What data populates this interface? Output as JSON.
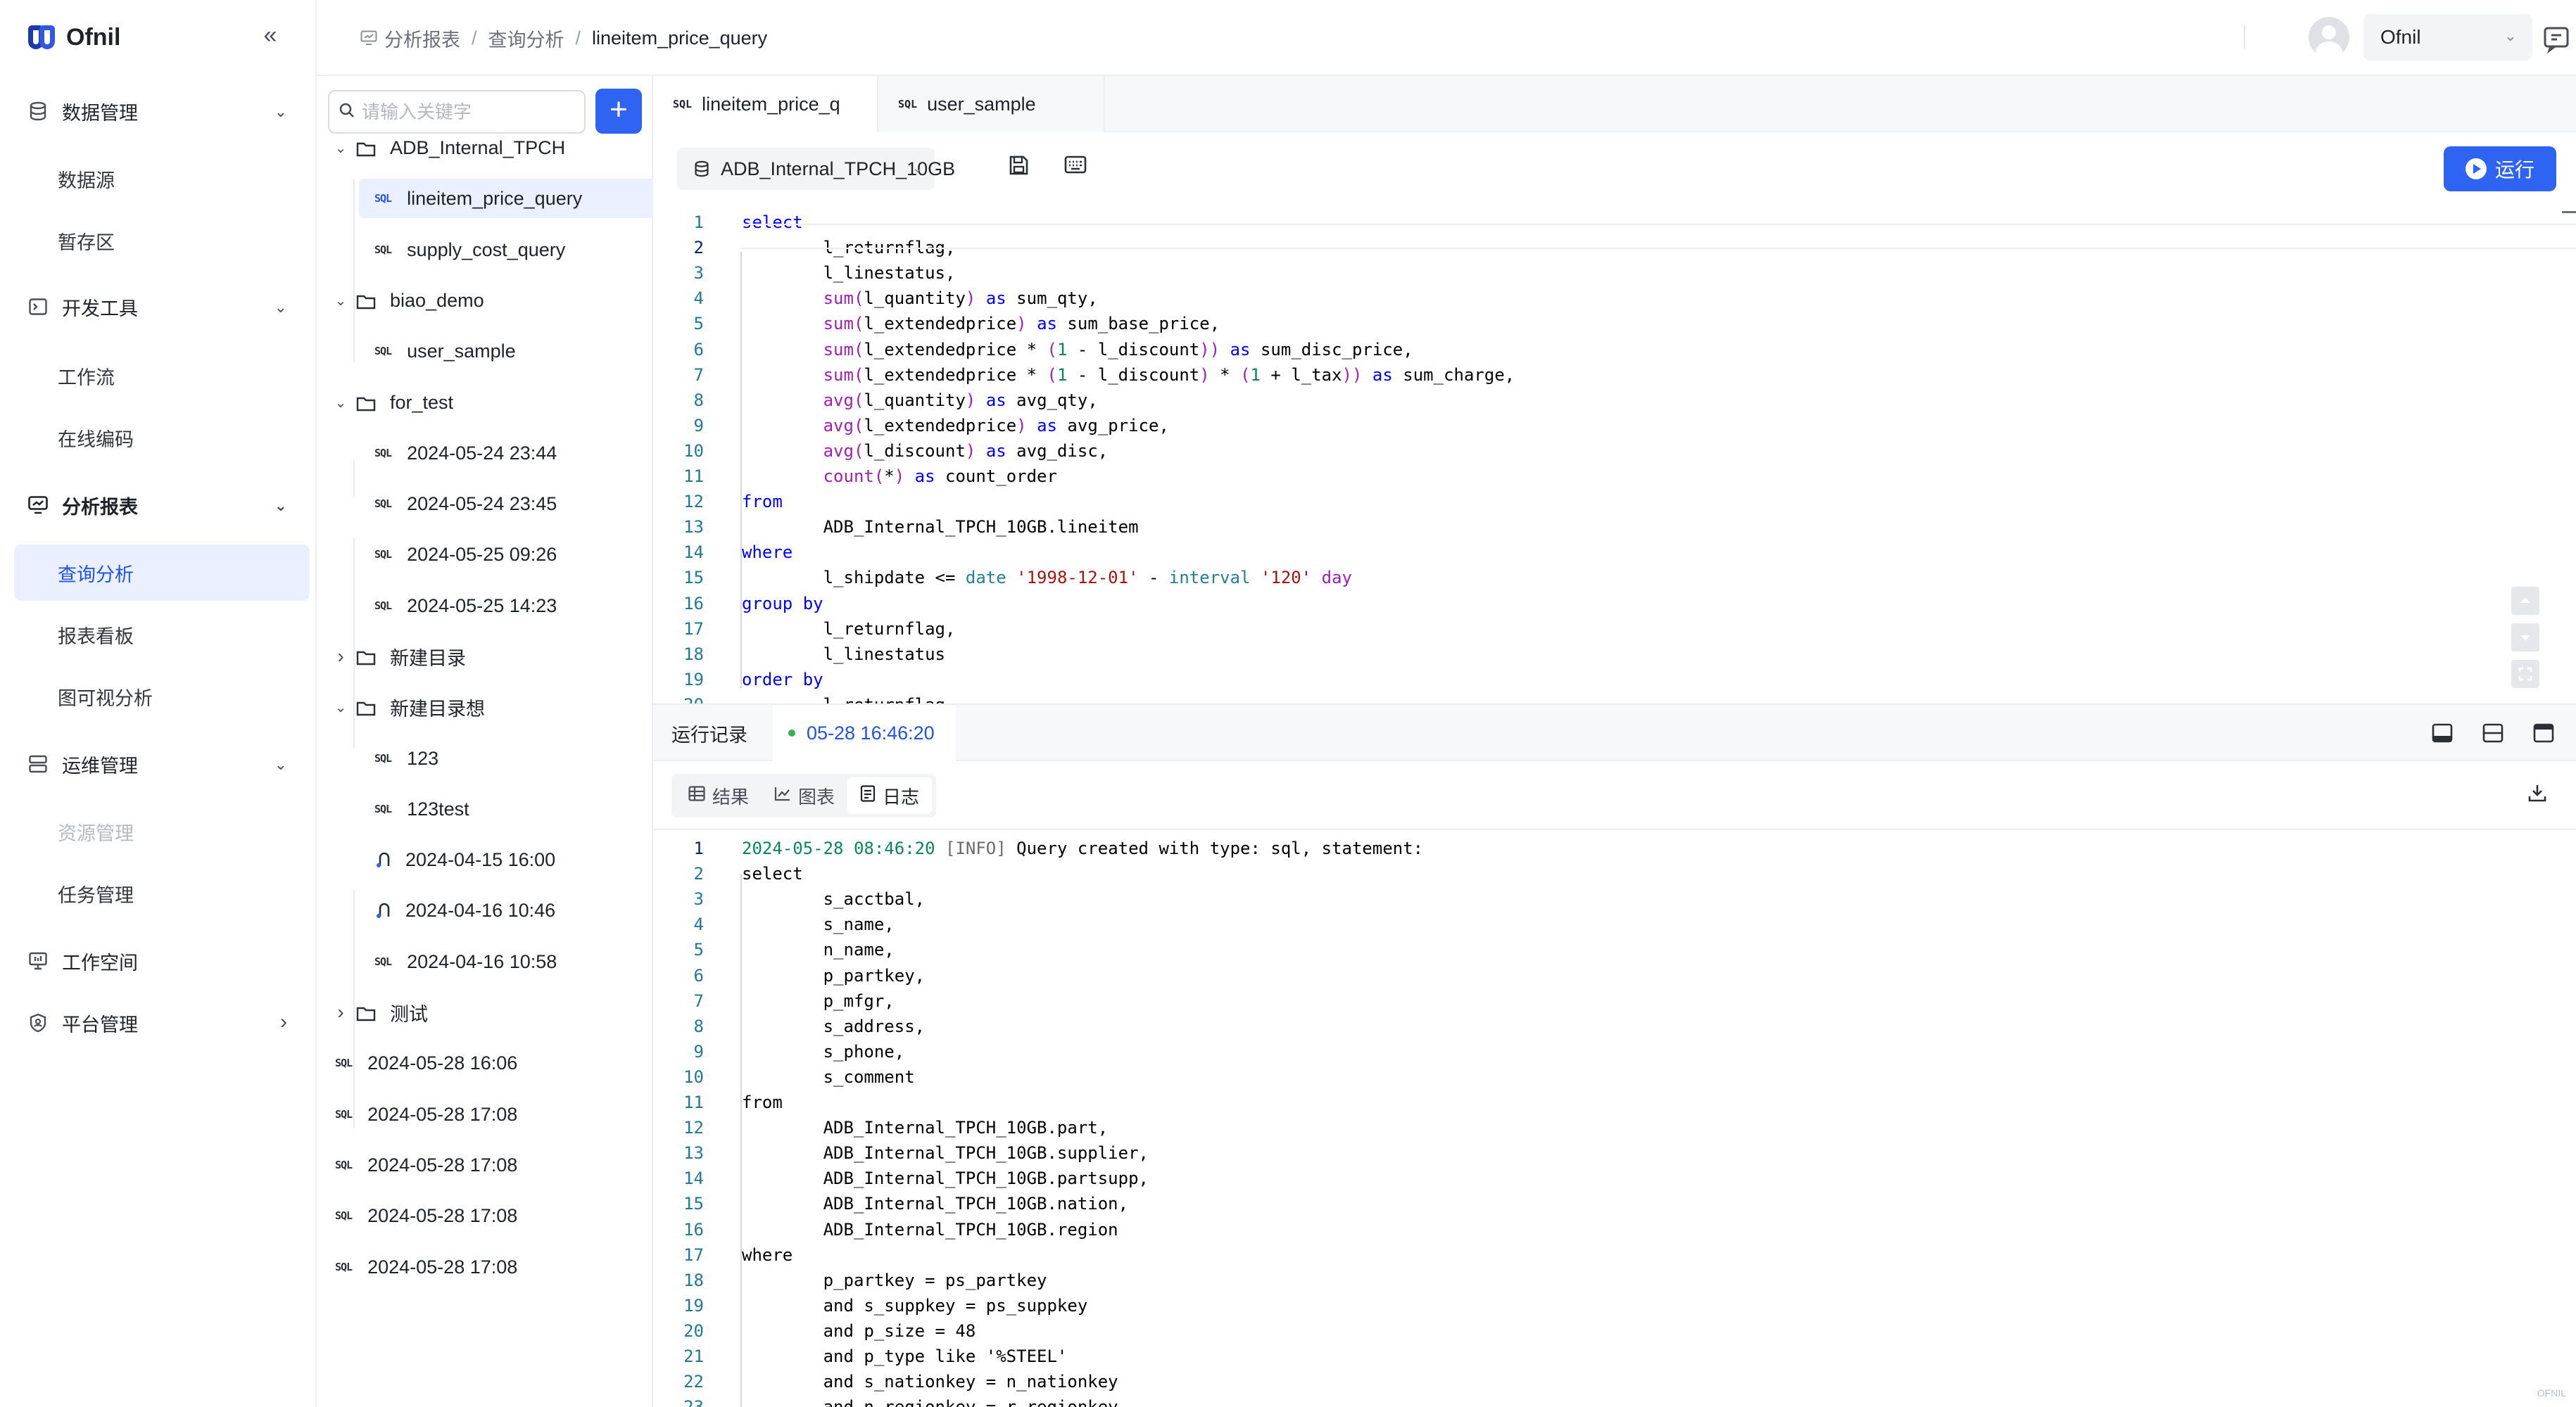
{
  "brand": {
    "name": "Ofnil"
  },
  "sidebar": {
    "groups": [
      {
        "label": "数据管理",
        "items": [
          "数据源",
          "暂存区"
        ]
      },
      {
        "label": "开发工具",
        "items": [
          "工作流",
          "在线编码"
        ]
      },
      {
        "label": "分析报表",
        "items": [
          "查询分析",
          "报表看板",
          "图可视分析"
        ]
      },
      {
        "label": "运维管理",
        "items": [
          "资源管理",
          "任务管理"
        ]
      },
      {
        "label": "工作空间",
        "items": []
      },
      {
        "label": "平台管理",
        "items": []
      }
    ]
  },
  "header": {
    "breadcrumb": [
      "分析报表",
      "查询分析",
      "lineitem_price_query"
    ],
    "user": "Ofnil"
  },
  "tree": {
    "search_placeholder": "请输入关键字",
    "nodes": [
      {
        "type": "folder",
        "label": "ADB_Internal_TPCH",
        "expanded": true
      },
      {
        "type": "sql",
        "label": "lineitem_price_query",
        "selected": true
      },
      {
        "type": "sql",
        "label": "supply_cost_query"
      },
      {
        "type": "folder",
        "label": "biao_demo",
        "expanded": true
      },
      {
        "type": "sql",
        "label": "user_sample"
      },
      {
        "type": "folder",
        "label": "for_test",
        "expanded": true
      },
      {
        "type": "sql",
        "label": "2024-05-24 23:44"
      },
      {
        "type": "sql",
        "label": "2024-05-24 23:45"
      },
      {
        "type": "sql",
        "label": "2024-05-25 09:26"
      },
      {
        "type": "sql",
        "label": "2024-05-25 14:23"
      },
      {
        "type": "folder",
        "label": "新建目录",
        "expanded": false
      },
      {
        "type": "folder",
        "label": "新建目录想",
        "expanded": true
      },
      {
        "type": "sql",
        "label": "123"
      },
      {
        "type": "sql",
        "label": "123test"
      },
      {
        "type": "flow",
        "label": "2024-04-15 16:00"
      },
      {
        "type": "flow",
        "label": "2024-04-16 10:46"
      },
      {
        "type": "sql",
        "label": "2024-04-16 10:58"
      },
      {
        "type": "folder",
        "label": "测试",
        "expanded": false
      },
      {
        "type": "sql",
        "label": "2024-05-28 16:06"
      },
      {
        "type": "sql",
        "label": "2024-05-28 17:08"
      },
      {
        "type": "sql",
        "label": "2024-05-28 17:08"
      },
      {
        "type": "sql",
        "label": "2024-05-28 17:08"
      },
      {
        "type": "sql",
        "label": "2024-05-28 17:08"
      }
    ]
  },
  "editor": {
    "tabs": [
      {
        "label": "lineitem_price_q",
        "active": true
      },
      {
        "label": "user_sample",
        "active": false
      }
    ],
    "datasource": "ADB_Internal_TPCH_10GB",
    "run_label": "运行",
    "current_line": 2,
    "lines": [
      "select",
      "        l_returnflag,",
      "        l_linestatus,",
      "        sum(l_quantity) as sum_qty,",
      "        sum(l_extendedprice) as sum_base_price,",
      "        sum(l_extendedprice * (1 - l_discount)) as sum_disc_price,",
      "        sum(l_extendedprice * (1 - l_discount) * (1 + l_tax)) as sum_charge,",
      "        avg(l_quantity) as avg_qty,",
      "        avg(l_extendedprice) as avg_price,",
      "        avg(l_discount) as avg_disc,",
      "        count(*) as count_order",
      "from",
      "        ADB_Internal_TPCH_10GB.lineitem",
      "where",
      "        l_shipdate <= date '1998-12-01' - interval '120' day",
      "group by",
      "        l_returnflag,",
      "        l_linestatus",
      "order by",
      "        l_returnflag,"
    ]
  },
  "run": {
    "records_label": "运行记录",
    "entry": "05-28 16:46:20",
    "result_tabs": [
      "结果",
      "图表",
      "日志"
    ],
    "active_result_tab": "日志",
    "log_first": {
      "time": "2024-05-28 08:46:20",
      "tag": "[INFO]",
      "msg": " Query created with type: sql, statement:"
    },
    "log_lines": [
      "select",
      "        s_acctbal,",
      "        s_name,",
      "        n_name,",
      "        p_partkey,",
      "        p_mfgr,",
      "        s_address,",
      "        s_phone,",
      "        s_comment",
      "from",
      "        ADB_Internal_TPCH_10GB.part,",
      "        ADB_Internal_TPCH_10GB.supplier,",
      "        ADB_Internal_TPCH_10GB.partsupp,",
      "        ADB_Internal_TPCH_10GB.nation,",
      "        ADB_Internal_TPCH_10GB.region",
      "where",
      "        p_partkey = ps_partkey",
      "        and s_suppkey = ps_suppkey",
      "        and p_size = 48",
      "        and p_type like '%STEEL'",
      "        and s_nationkey = n_nationkey",
      "        and n_regionkey = r_regionkey"
    ]
  },
  "footer": {
    "mark": "OFNIL"
  },
  "colors": {
    "accent": "#2f63f1",
    "selected_bg": "#eaf0ff",
    "keyword": "#0000ff",
    "function": "#a020b0",
    "string": "#a31515"
  }
}
